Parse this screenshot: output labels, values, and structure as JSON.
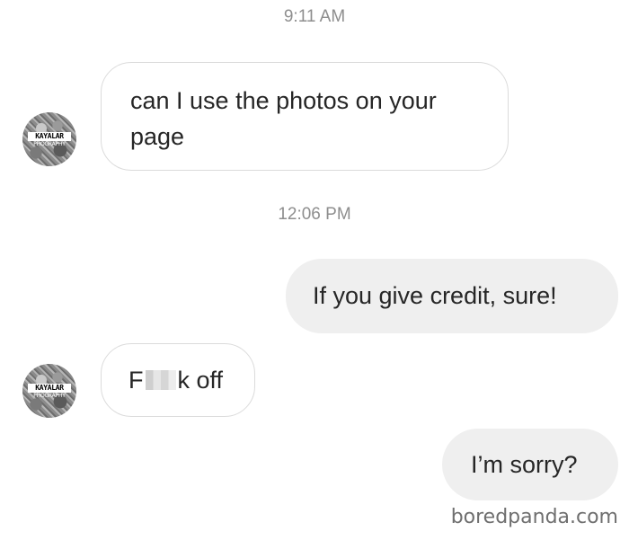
{
  "conversation": {
    "timestamps": [
      "9:11 AM",
      "12:06 PM"
    ],
    "messages": [
      {
        "direction": "incoming",
        "text": "can I use the photos on your page"
      },
      {
        "direction": "outgoing",
        "text": "If you give credit, sure!"
      },
      {
        "direction": "incoming",
        "text_before": "F",
        "text_after": "k off",
        "censored": true
      },
      {
        "direction": "outgoing",
        "text": "I’m sorry?"
      }
    ]
  },
  "sender": {
    "avatar_label_top": "KAYALAR",
    "avatar_label_bottom": "PHOGRAPHY"
  },
  "watermark": "boredpanda.com",
  "colors": {
    "timestamp": "#8e8e8e",
    "incoming_border": "#dbdbdb",
    "outgoing_background": "#efefef",
    "text": "#262626"
  }
}
